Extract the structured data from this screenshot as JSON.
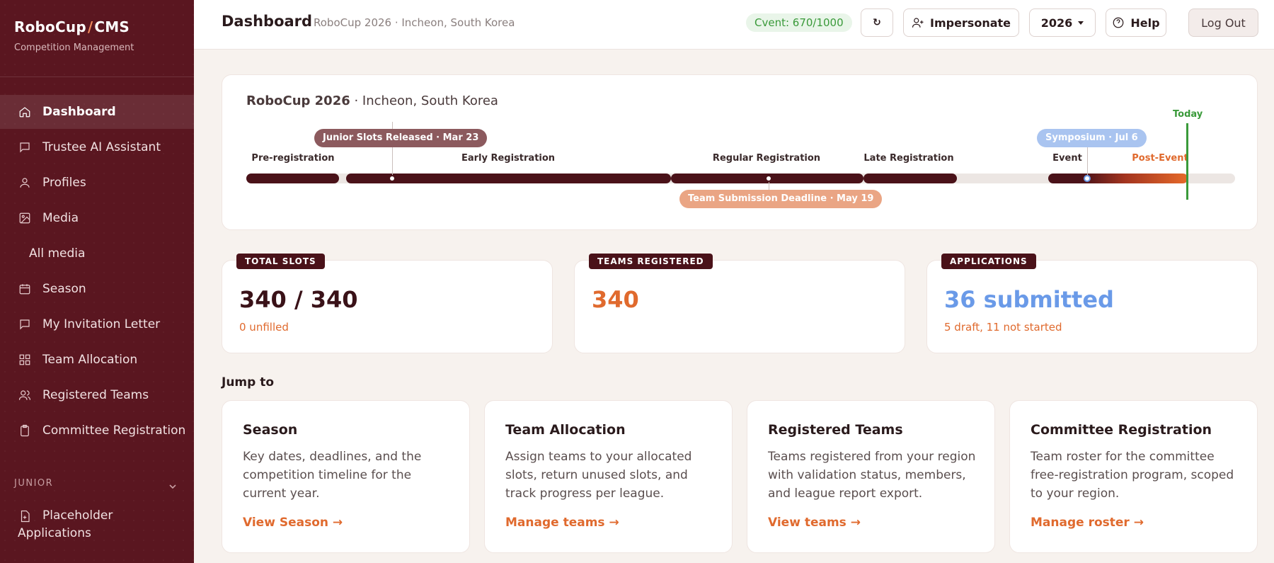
{
  "sidebar": {
    "brand_left": "RoboCup",
    "brand_slash": "/",
    "brand_right": "CMS",
    "brand_sub": "Competition Management",
    "items": [
      {
        "label": "Dashboard",
        "icon": "home-icon"
      },
      {
        "label": "Trustee AI Assistant",
        "icon": "chat-icon"
      },
      {
        "label": "Profiles",
        "icon": "user-icon"
      },
      {
        "label": "Media",
        "icon": "image-icon"
      },
      {
        "label": "All media"
      },
      {
        "label": "Season",
        "icon": "calendar-icon"
      },
      {
        "label": "My Invitation Letter",
        "icon": "chat-icon"
      },
      {
        "label": "Team Allocation",
        "icon": "grid-icon"
      },
      {
        "label": "Registered Teams",
        "icon": "users-icon"
      },
      {
        "label": "Committee Registration",
        "icon": "clipboard-icon"
      }
    ],
    "section": "JUNIOR",
    "placeholder_line1": "Placeholder",
    "placeholder_line2": "Applications"
  },
  "header": {
    "title": "Dashboard",
    "subtitle": "RoboCup 2026 · Incheon, South Korea",
    "cvent": "Cvent: 670/1000",
    "refresh": "↻",
    "impersonate": "Impersonate",
    "year": "2026",
    "help": "Help",
    "logout": "Log Out"
  },
  "timeline": {
    "title_bold": "RoboCup 2026",
    "title_rest": " · Incheon, South Korea",
    "phases": [
      "Pre-registration",
      "Early Registration",
      "Regular Registration",
      "Late Registration",
      "Event",
      "Post-Event"
    ],
    "milestones": {
      "junior": "Junior Slots Released · Mar 23",
      "team": "Team Submission Deadline · May 19",
      "symposium": "Symposium · Jul 6"
    },
    "today": "Today"
  },
  "stats": [
    {
      "badge": "TOTAL SLOTS",
      "value": "340 / 340",
      "note": "0 unfilled",
      "color": "#3a1218"
    },
    {
      "badge": "TEAMS REGISTERED",
      "value": "340",
      "note": "",
      "color": "#e06a2e"
    },
    {
      "badge": "APPLICATIONS",
      "value": "36 submitted",
      "note": "5 draft, 11 not started",
      "color": "#6a9ae8"
    }
  ],
  "jump_label": "Jump to",
  "jump": [
    {
      "title": "Season",
      "desc": "Key dates, deadlines, and the competition timeline for the current year.",
      "link": "View Season →"
    },
    {
      "title": "Team Allocation",
      "desc": "Assign teams to your allocated slots, return unused slots, and track progress per league.",
      "link": "Manage teams →"
    },
    {
      "title": "Registered Teams",
      "desc": "Teams registered from your region with validation status, members, and league report export.",
      "link": "View teams →"
    },
    {
      "title": "Committee Registration",
      "desc": "Team roster for the committee free-registration program, scoped to your region.",
      "link": "Manage roster →"
    }
  ],
  "colors": {
    "sidebar": "#5a1620",
    "accent": "#e06a2e",
    "dark": "#4a1219",
    "today": "#3a9a3a"
  }
}
